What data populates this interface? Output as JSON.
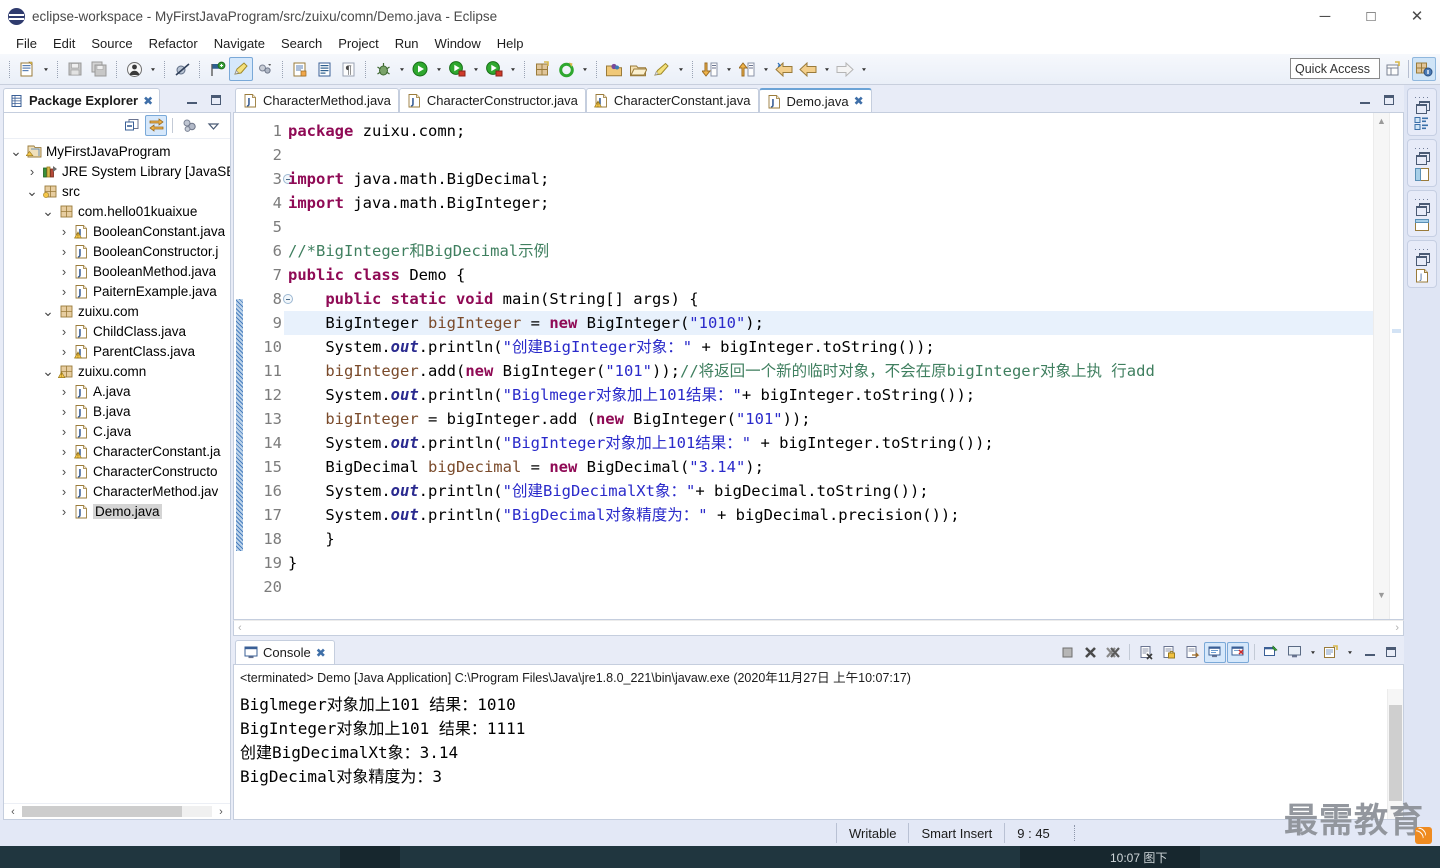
{
  "window": {
    "title": "eclipse-workspace - MyFirstJavaProgram/src/zuixu/comn/Demo.java - Eclipse",
    "minimize": "─",
    "maximize": "□",
    "close": "✕"
  },
  "menubar": {
    "items": [
      "File",
      "Edit",
      "Source",
      "Refactor",
      "Navigate",
      "Search",
      "Project",
      "Run",
      "Window",
      "Help"
    ]
  },
  "toolbar": {
    "quick_access_placeholder": "Quick Access",
    "buttons": [
      {
        "name": "new-wizard-icon",
        "title": "New"
      },
      {
        "name": "save-icon",
        "title": "Save"
      },
      {
        "name": "save-all-icon",
        "title": "Save All"
      },
      {
        "name": "toggle-breadcrumb-icon",
        "title": "Toggle Breadcrumb"
      },
      {
        "name": "skip-breakpoints-icon",
        "title": "Skip All Breakpoints"
      },
      {
        "name": "next-annotation-icon",
        "title": "Next Annotation"
      },
      {
        "name": "mark-occurrences-icon",
        "title": "Toggle Mark Occurrences"
      },
      {
        "name": "open-type-icon",
        "title": "Open Type"
      },
      {
        "name": "new-java-class-icon",
        "title": "New Java Class"
      },
      {
        "name": "new-java-package-icon",
        "title": "New Java Package"
      },
      {
        "name": "pilcrow-icon",
        "title": "Show Whitespace"
      },
      {
        "name": "debug-icon",
        "title": "Debug"
      },
      {
        "name": "run-icon",
        "title": "Run"
      },
      {
        "name": "coverage-icon",
        "title": "Coverage"
      },
      {
        "name": "external-tools-icon",
        "title": "External Tools"
      },
      {
        "name": "new-package-wizard-icon",
        "title": "New Package"
      },
      {
        "name": "refresh-icon",
        "title": "Refresh"
      },
      {
        "name": "open-perspective-icon",
        "title": "Open Perspective"
      },
      {
        "name": "open-folder-icon",
        "title": "Open Folder"
      },
      {
        "name": "quick-fix-icon",
        "title": "Quick Fix"
      },
      {
        "name": "previous-edit-icon",
        "title": "Previous Edit Location"
      },
      {
        "name": "next-edit-icon",
        "title": "Next Edit Location"
      },
      {
        "name": "back-icon",
        "title": "Back"
      },
      {
        "name": "back-history-icon",
        "title": "Back History"
      },
      {
        "name": "forward-icon",
        "title": "Forward"
      }
    ],
    "perspective_new": "open-perspective-icon",
    "perspective_java": "java-perspective-icon"
  },
  "explorer": {
    "tab_label": "Package Explorer",
    "tab_close": "✖",
    "toolbar": [
      {
        "name": "collapse-all-icon"
      },
      {
        "name": "link-with-editor-icon"
      },
      {
        "name": "view-menu-filter-icon"
      },
      {
        "name": "view-menu-icon"
      }
    ],
    "tree": [
      {
        "indent": 0,
        "twisty": "⌄",
        "icon": "java-project-icon",
        "label": "MyFirstJavaProgram",
        "selected": false
      },
      {
        "indent": 1,
        "twisty": "›",
        "icon": "jre-library-icon",
        "label": "JRE System Library [JavaSE-",
        "selected": false
      },
      {
        "indent": 1,
        "twisty": "⌄",
        "icon": "source-folder-icon",
        "label": "src",
        "selected": false
      },
      {
        "indent": 2,
        "twisty": "⌄",
        "icon": "package-icon",
        "label": "com.hello01kuaixue",
        "selected": false
      },
      {
        "indent": 3,
        "twisty": "›",
        "icon": "java-file-warning-icon",
        "label": "BooleanConstant.java",
        "selected": false
      },
      {
        "indent": 3,
        "twisty": "›",
        "icon": "java-file-icon",
        "label": "BooleanConstructor.j",
        "selected": false
      },
      {
        "indent": 3,
        "twisty": "›",
        "icon": "java-file-icon",
        "label": "BooleanMethod.java",
        "selected": false
      },
      {
        "indent": 3,
        "twisty": "›",
        "icon": "java-file-icon",
        "label": "PaiternExample.java",
        "selected": false
      },
      {
        "indent": 2,
        "twisty": "⌄",
        "icon": "package-icon",
        "label": "zuixu.com",
        "selected": false
      },
      {
        "indent": 3,
        "twisty": "›",
        "icon": "java-file-icon",
        "label": "ChildClass.java",
        "selected": false
      },
      {
        "indent": 3,
        "twisty": "›",
        "icon": "java-file-warning-icon",
        "label": "ParentClass.java",
        "selected": false
      },
      {
        "indent": 2,
        "twisty": "⌄",
        "icon": "package-warning-icon",
        "label": "zuixu.comn",
        "selected": false
      },
      {
        "indent": 3,
        "twisty": "›",
        "icon": "java-file-icon",
        "label": "A.java",
        "selected": false
      },
      {
        "indent": 3,
        "twisty": "›",
        "icon": "java-file-icon",
        "label": "B.java",
        "selected": false
      },
      {
        "indent": 3,
        "twisty": "›",
        "icon": "java-file-icon",
        "label": "C.java",
        "selected": false
      },
      {
        "indent": 3,
        "twisty": "›",
        "icon": "java-file-warning-icon",
        "label": "CharacterConstant.ja",
        "selected": false
      },
      {
        "indent": 3,
        "twisty": "›",
        "icon": "java-file-icon",
        "label": "CharacterConstructo",
        "selected": false
      },
      {
        "indent": 3,
        "twisty": "›",
        "icon": "java-file-icon",
        "label": "CharacterMethod.jav",
        "selected": false
      },
      {
        "indent": 3,
        "twisty": "›",
        "icon": "java-file-icon",
        "label": "Demo.java",
        "selected": true
      }
    ],
    "hscroll_left": "‹",
    "hscroll_right": "›"
  },
  "editor": {
    "tabs": [
      {
        "label": "CharacterMethod.java",
        "icon": "java-file-icon",
        "active": false,
        "close": ""
      },
      {
        "label": "CharacterConstructor.java",
        "icon": "java-file-icon",
        "active": false,
        "close": ""
      },
      {
        "label": "CharacterConstant.java",
        "icon": "java-file-warning-icon",
        "active": false,
        "close": ""
      },
      {
        "label": "Demo.java",
        "icon": "java-file-icon",
        "active": true,
        "close": "✖"
      }
    ],
    "first_line": 1,
    "total_lines": 20,
    "highlight_line": 9,
    "lines": [
      {
        "n": 1,
        "fold": false,
        "html": "<span class=\"kw\">package</span> <span class=\"pln\">zuixu.comn;</span>"
      },
      {
        "n": 2,
        "fold": false,
        "html": ""
      },
      {
        "n": 3,
        "fold": true,
        "html": "<span class=\"kw\">import</span> <span class=\"pln\">java.math.BigDecimal;</span>"
      },
      {
        "n": 4,
        "fold": false,
        "html": "<span class=\"kw\">import</span> <span class=\"pln\">java.math.BigInteger;</span>"
      },
      {
        "n": 5,
        "fold": false,
        "html": ""
      },
      {
        "n": 6,
        "fold": false,
        "html": "<span class=\"cmt\">//*BigInteger和BigDecimal示例</span>"
      },
      {
        "n": 7,
        "fold": false,
        "html": "<span class=\"kw\">public class</span> <span class=\"pln\">Demo {</span>"
      },
      {
        "n": 8,
        "fold": true,
        "html": "    <span class=\"kw\">public static void</span> <span class=\"pln\">main(String[] args) {</span>"
      },
      {
        "n": 9,
        "fold": false,
        "html": "    <span class=\"pln\">BigInteger </span><span class=\"fld\">bigInteger</span><span class=\"pln\"> = </span><span class=\"kw\">new</span><span class=\"pln\"> BigInteger(</span><span class=\"str\">\"1010\"</span><span class=\"pln\">);</span>"
      },
      {
        "n": 10,
        "fold": false,
        "html": "    <span class=\"pln\">System.</span><span class=\"sfield\">out</span><span class=\"pln\">.println(</span><span class=\"str\">\"创建BigInteger对象：\"</span><span class=\"pln\"> + bigInteger.toString());</span>"
      },
      {
        "n": 11,
        "fold": false,
        "html": "    <span class=\"fld\">bigInteger</span><span class=\"pln\">.add(</span><span class=\"kw\">new</span><span class=\"pln\"> BigInteger(</span><span class=\"str\">\"101\"</span><span class=\"pln\">));</span><span class=\"cmt\">//将返回一个新的临时对象，不会在原bigInteger对象上执 行add</span>"
      },
      {
        "n": 12,
        "fold": false,
        "html": "    <span class=\"pln\">System.</span><span class=\"sfield\">out</span><span class=\"pln\">.println(</span><span class=\"str\">\"Biglmeger对象加上101结果：\"</span><span class=\"pln\">+ bigInteger.toString());</span>"
      },
      {
        "n": 13,
        "fold": false,
        "html": "    <span class=\"fld\">bigInteger</span><span class=\"pln\"> = bigInteger.add (</span><span class=\"kw\">new</span><span class=\"pln\"> BigInteger(</span><span class=\"str\">\"101\"</span><span class=\"pln\">));</span>"
      },
      {
        "n": 14,
        "fold": false,
        "html": "    <span class=\"pln\">System.</span><span class=\"sfield\">out</span><span class=\"pln\">.println(</span><span class=\"str\">\"BigInteger对象加上101结果：\"</span><span class=\"pln\"> + bigInteger.toString());</span>"
      },
      {
        "n": 15,
        "fold": false,
        "html": "    <span class=\"pln\">BigDecimal </span><span class=\"fld\">bigDecimal</span><span class=\"pln\"> = </span><span class=\"kw\">new</span><span class=\"pln\"> BigDecimal(</span><span class=\"str\">\"3.14\"</span><span class=\"pln\">);</span>"
      },
      {
        "n": 16,
        "fold": false,
        "html": "    <span class=\"pln\">System.</span><span class=\"sfield\">out</span><span class=\"pln\">.println(</span><span class=\"str\">\"创建BigDecimalXt象：\"</span><span class=\"pln\">+ bigDecimal.toString());</span>"
      },
      {
        "n": 17,
        "fold": false,
        "html": "    <span class=\"pln\">System.</span><span class=\"sfield\">out</span><span class=\"pln\">.println(</span><span class=\"str\">\"BigDecimal对象精度为：\"</span><span class=\"pln\"> + bigDecimal.precision());</span>"
      },
      {
        "n": 18,
        "fold": false,
        "html": "    <span class=\"pln\">}</span>"
      },
      {
        "n": 19,
        "fold": false,
        "html": "<span class=\"pln\">}</span>"
      },
      {
        "n": 20,
        "fold": false,
        "html": ""
      }
    ],
    "hscroll_left": "‹",
    "hscroll_right": "›"
  },
  "console": {
    "tab_label": "Console",
    "tab_close": "✖",
    "header": "<terminated> Demo [Java Application] C:\\Program Files\\Java\\jre1.8.0_221\\bin\\javaw.exe (2020年11月27日 上午10:07:17)",
    "output": [
      "Biglmeger对象加上101 结果：1010",
      "BigInteger对象加上101 结果：1111",
      "创建BigDecimalXt象：3.14",
      "BigDecimal对象精度为：3"
    ],
    "toolbar": [
      {
        "name": "terminate-icon"
      },
      {
        "name": "remove-launch-icon"
      },
      {
        "name": "remove-all-terminated-icon"
      },
      {
        "name": "clear-console-icon"
      },
      {
        "name": "scroll-lock-icon"
      },
      {
        "name": "word-wrap-icon"
      },
      {
        "name": "show-console-on-output-icon"
      },
      {
        "name": "show-console-on-error-icon"
      },
      {
        "name": "pin-console-icon"
      },
      {
        "name": "display-selected-console-icon"
      },
      {
        "name": "open-console-icon"
      },
      {
        "name": "minimize-icon"
      },
      {
        "name": "maximize-icon"
      }
    ]
  },
  "right_strip": [
    {
      "name": "outline-view-icon"
    },
    {
      "name": "task-list-view-icon"
    },
    {
      "name": "editor-area-icon"
    },
    {
      "name": "java-editor-icon"
    }
  ],
  "statusbar": {
    "writable": "Writable",
    "insert_mode": "Smart Insert",
    "position": "9 : 45",
    "watermark": "最需教育"
  },
  "taskbar": {
    "text": "10:07 图下"
  },
  "colors": {
    "accent": "#2f3b6e",
    "tab_active_border": "#6ba3d6",
    "keyword": "#8f0a55",
    "string": "#2a2aca",
    "comment": "#3f7f5f",
    "field": "#7a4a2a",
    "static_field": "#2a2a8f",
    "line_highlight": "#e8f1fc",
    "selection_gray": "#d4d4d4",
    "toolbar_bg": "#eaeff8",
    "chrome_bg": "#e8ecf7"
  }
}
